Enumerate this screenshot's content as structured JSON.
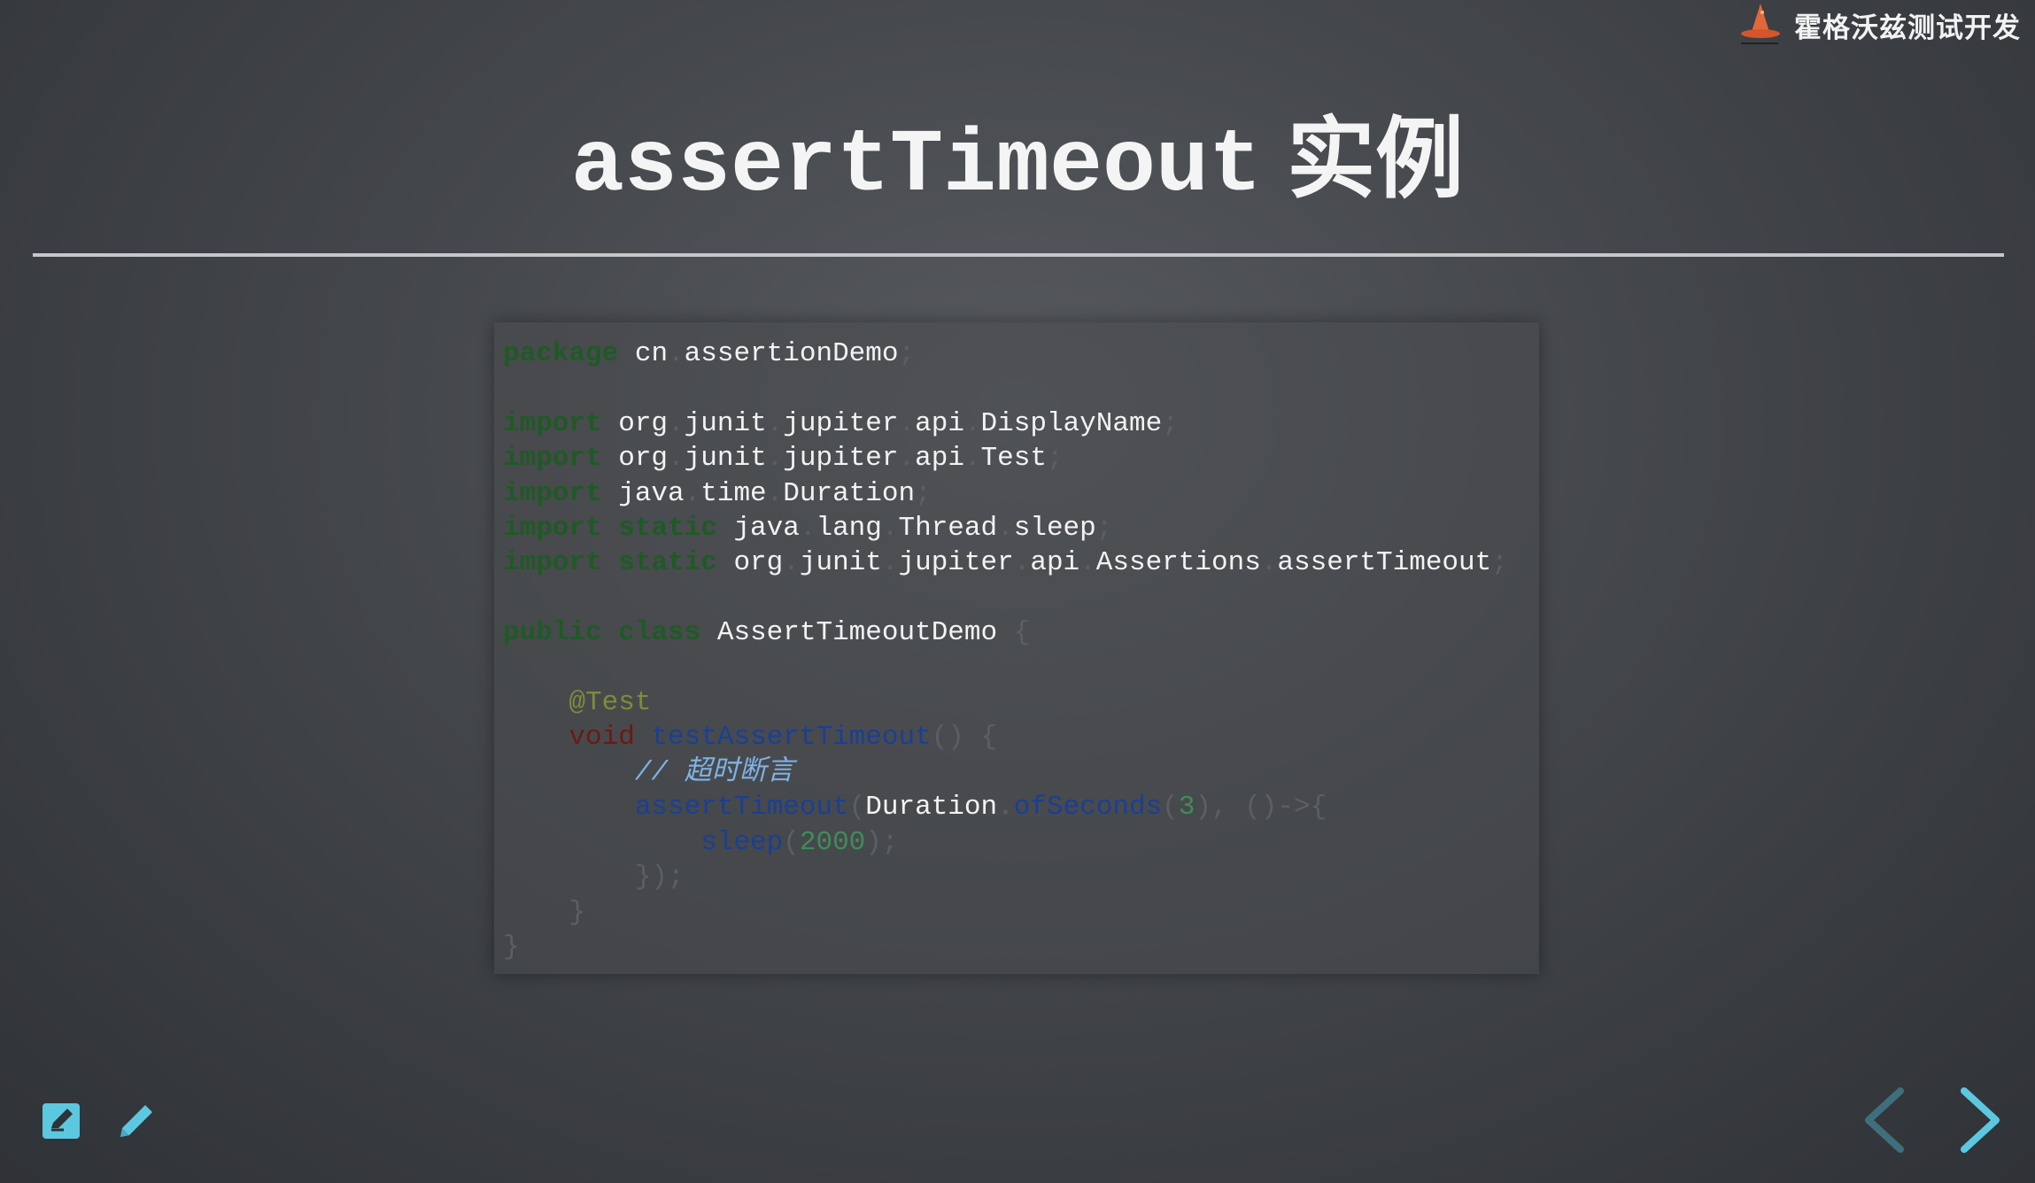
{
  "brand": {
    "name": "霍格沃兹测试开发",
    "icon": "wizard-hat-icon"
  },
  "slide": {
    "title_code": "assertTimeout",
    "title_suffix": "实例"
  },
  "code": {
    "lines": [
      [
        [
          "kw",
          "package"
        ],
        [
          "cls",
          " cn"
        ],
        [
          "pun",
          "."
        ],
        [
          "cls",
          "assertionDemo"
        ],
        [
          "pun",
          ";"
        ]
      ],
      [],
      [
        [
          "kw",
          "import"
        ],
        [
          "cls",
          " org"
        ],
        [
          "pun",
          "."
        ],
        [
          "cls",
          "junit"
        ],
        [
          "pun",
          "."
        ],
        [
          "cls",
          "jupiter"
        ],
        [
          "pun",
          "."
        ],
        [
          "cls",
          "api"
        ],
        [
          "pun",
          "."
        ],
        [
          "cls",
          "DisplayName"
        ],
        [
          "pun",
          ";"
        ]
      ],
      [
        [
          "kw",
          "import"
        ],
        [
          "cls",
          " org"
        ],
        [
          "pun",
          "."
        ],
        [
          "cls",
          "junit"
        ],
        [
          "pun",
          "."
        ],
        [
          "cls",
          "jupiter"
        ],
        [
          "pun",
          "."
        ],
        [
          "cls",
          "api"
        ],
        [
          "pun",
          "."
        ],
        [
          "cls",
          "Test"
        ],
        [
          "pun",
          ";"
        ]
      ],
      [
        [
          "kw",
          "import"
        ],
        [
          "cls",
          " java"
        ],
        [
          "pun",
          "."
        ],
        [
          "cls",
          "time"
        ],
        [
          "pun",
          "."
        ],
        [
          "cls",
          "Duration"
        ],
        [
          "pun",
          ";"
        ]
      ],
      [
        [
          "kw",
          "import static"
        ],
        [
          "cls",
          " java"
        ],
        [
          "pun",
          "."
        ],
        [
          "cls",
          "lang"
        ],
        [
          "pun",
          "."
        ],
        [
          "cls",
          "Thread"
        ],
        [
          "pun",
          "."
        ],
        [
          "cls",
          "sleep"
        ],
        [
          "pun",
          ";"
        ]
      ],
      [
        [
          "kw",
          "import static"
        ],
        [
          "cls",
          " org"
        ],
        [
          "pun",
          "."
        ],
        [
          "cls",
          "junit"
        ],
        [
          "pun",
          "."
        ],
        [
          "cls",
          "jupiter"
        ],
        [
          "pun",
          "."
        ],
        [
          "cls",
          "api"
        ],
        [
          "pun",
          "."
        ],
        [
          "cls",
          "Assertions"
        ],
        [
          "pun",
          "."
        ],
        [
          "cls",
          "assertTimeout"
        ],
        [
          "pun",
          ";"
        ]
      ],
      [],
      [
        [
          "kw",
          "public class"
        ],
        [
          "cls",
          " AssertTimeoutDemo "
        ],
        [
          "pun",
          "{"
        ]
      ],
      [],
      [
        [
          "ann",
          "    @Test"
        ]
      ],
      [
        [
          "void",
          "    void "
        ],
        [
          "fn",
          "testAssertTimeout"
        ],
        [
          "pun",
          "() {"
        ]
      ],
      [
        [
          "cm",
          "        // 超时断言"
        ]
      ],
      [
        [
          "fn",
          "        assertTimeout"
        ],
        [
          "pun",
          "("
        ],
        [
          "cls",
          "Duration"
        ],
        [
          "pun",
          "."
        ],
        [
          "fn",
          "ofSeconds"
        ],
        [
          "pun",
          "("
        ],
        [
          "num",
          "3"
        ],
        [
          "pun",
          "), ()->{"
        ]
      ],
      [
        [
          "fn",
          "            sleep"
        ],
        [
          "pun",
          "("
        ],
        [
          "num",
          "2000"
        ],
        [
          "pun",
          ");"
        ]
      ],
      [
        [
          "pun",
          "        });"
        ]
      ],
      [
        [
          "pun",
          "    }"
        ]
      ],
      [
        [
          "pun",
          "}"
        ]
      ]
    ]
  },
  "nav": {
    "edit_icon": "edit-note-icon",
    "pen_icon": "pencil-icon",
    "prev_icon": "chevron-left-icon",
    "next_icon": "chevron-right-icon"
  },
  "colors": {
    "accent": "#5bc8e0",
    "keyword": "#1f5a25",
    "function": "#1a3f93",
    "annotation": "#7f8a3c",
    "comment": "#7fb2e6",
    "number": "#3f8c58"
  }
}
